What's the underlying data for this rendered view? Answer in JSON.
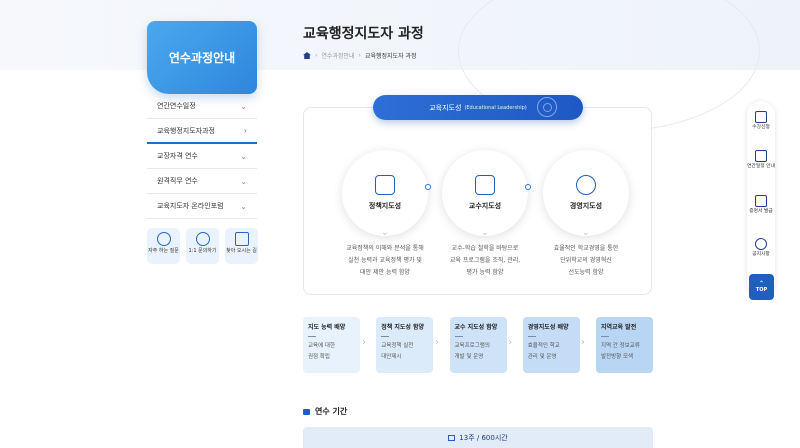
{
  "sidebar": {
    "badge": "연수과정안내",
    "items": [
      {
        "label": "연간연수일정"
      },
      {
        "label": "교육행정지도자과정"
      },
      {
        "label": "교장자격 연수"
      },
      {
        "label": "원격직무 연수"
      },
      {
        "label": "교육지도자 온라인포럼"
      }
    ],
    "quick": [
      {
        "label": "자주 하는 질문",
        "icon": "faq-icon"
      },
      {
        "label": "1:1 문의하기",
        "icon": "inquiry-icon"
      },
      {
        "label": "찾아 오시는 길",
        "icon": "map-icon"
      }
    ]
  },
  "page": {
    "title": "교육행정지도자 과정",
    "breadcrumb": [
      "연수과정안내",
      "교육행정지도자 과정"
    ]
  },
  "leadership": {
    "title": "교육지도성",
    "subtitle": "(Educational Leadership)",
    "pillars": [
      {
        "label": "정책지도성",
        "icon": "policy-book-icon",
        "desc": [
          "교육정책의 이해와 분석을 통해",
          "실천 능력과 교육정책 평가 및",
          "대안 제안 능력 함양"
        ]
      },
      {
        "label": "교수지도성",
        "icon": "teaching-board-icon",
        "desc": [
          "교수-학습 철학을 바탕으로",
          "교육 프로그램을 조직, 관리,",
          "평가 능력 함양"
        ]
      },
      {
        "label": "경영지도성",
        "icon": "management-hand-icon",
        "desc": [
          "효율적인 학교경영을 통한",
          "단위학교의 경영혁신",
          "선도능력 함양"
        ]
      }
    ]
  },
  "steps": [
    {
      "title": "지도 능력 배양",
      "desc": [
        "교육에 대한",
        "권점 확립"
      ]
    },
    {
      "title": "정책 지도성 함양",
      "desc": [
        "교육정책 실천",
        "대안제시"
      ]
    },
    {
      "title": "교수 지도성 함양",
      "desc": [
        "교육프로그램의",
        "개발 및 운영"
      ]
    },
    {
      "title": "경영지도성 배양",
      "desc": [
        "효율적인 학교",
        "관리 및 운영"
      ]
    },
    {
      "title": "지역교육 발전",
      "desc": [
        "지역 간 정보교류",
        "발전방향 모색"
      ]
    }
  ],
  "period": {
    "label": "연수 기간",
    "value": "13주 / 600시간"
  },
  "rightbar": {
    "items": [
      {
        "label": "수강신청",
        "icon": "apply-icon"
      },
      {
        "label": "연간일정 안내",
        "icon": "calendar-icon"
      },
      {
        "label": "증명서 발급",
        "icon": "certificate-icon"
      },
      {
        "label": "공지사항",
        "icon": "megaphone-icon"
      }
    ],
    "top": "TOP"
  },
  "colors": {
    "primary": "#1f5fbf",
    "accent": "#4aa8ee"
  }
}
